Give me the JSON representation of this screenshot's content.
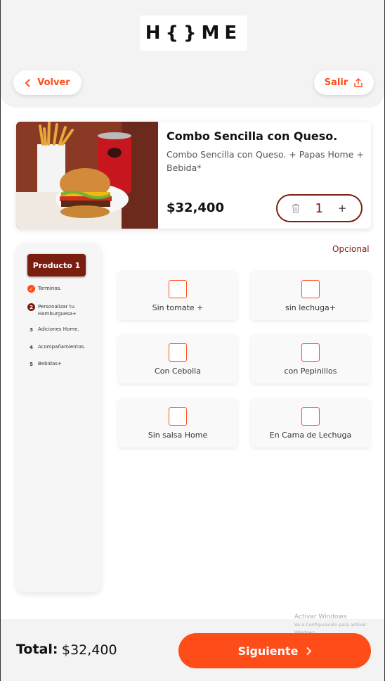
{
  "header": {
    "logo_text": "H{}ME",
    "back_label": "Volver",
    "exit_label": "Salir"
  },
  "product": {
    "title": "Combo Sencilla con Queso.",
    "description": "Combo Sencilla con Queso. + Papas Home + Bebida*",
    "price": "$32,400",
    "quantity": "1",
    "plus_label": "+"
  },
  "sidebar": {
    "product_button": "Producto 1",
    "steps": [
      {
        "num": "✓",
        "label": "Terminos.",
        "state": "done"
      },
      {
        "num": "2",
        "label": "Personalizar tu Hamburguesa+",
        "state": "active"
      },
      {
        "num": "3",
        "label": "Adiciones Home.",
        "state": "pending"
      },
      {
        "num": "4",
        "label": "Acompañamientos.",
        "state": "pending"
      },
      {
        "num": "5",
        "label": "Bebidas+",
        "state": "pending"
      }
    ]
  },
  "options": {
    "section_label": "Opcional",
    "items": [
      {
        "label": "Sin tomate +",
        "checked": false
      },
      {
        "label": "sin lechuga+",
        "checked": false
      },
      {
        "label": "Con Cebolla",
        "checked": false
      },
      {
        "label": "con Pepinillos",
        "checked": false
      },
      {
        "label": "Sin salsa Home",
        "checked": false
      },
      {
        "label": "En Cama de Lechuga",
        "checked": false
      }
    ]
  },
  "footer": {
    "total_label": "Total:",
    "total_value": "$32,400",
    "next_label": "Siguiente"
  },
  "watermark": {
    "line1": "Activar Windows",
    "line2": "Ve a Configuración para activar Windows."
  },
  "colors": {
    "accent": "#ff4d1a",
    "brand_dark": "#7a1e10",
    "background": "#f3f3f3"
  }
}
